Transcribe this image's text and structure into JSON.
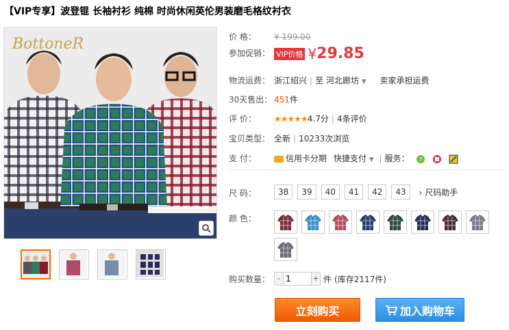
{
  "product": {
    "title": "【VIP专享】波登锟 长袖衬衫 纯棉 时尚休闲英伦男装磨毛格纹衬衣",
    "brand_logo": "BottoneR"
  },
  "price": {
    "label": "价  格：",
    "original": "¥ 199.00",
    "promo_label": "参加促销：",
    "vip_badge": "VIP价格",
    "currency": "¥",
    "current": "29.85"
  },
  "shipping": {
    "label": "物流运费：",
    "from": "浙江绍兴",
    "to_prefix": "至",
    "to": "河北廊坊",
    "fee": "卖家承担运费"
  },
  "sales": {
    "label": "30天售出：",
    "count": "451",
    "unit": "件"
  },
  "rating": {
    "label": "评  价：",
    "stars": "★★★★★",
    "score": "4.7分",
    "reviews": "4条评价"
  },
  "item_type": {
    "label": "宝贝类型：",
    "condition": "全新",
    "views": "10233次浏览"
  },
  "payment": {
    "label": "支  付：",
    "credit": "信用卡分期",
    "quick": "快捷支付",
    "service_label": "服务："
  },
  "sizes": {
    "label": "尺  码：",
    "options": [
      "38",
      "39",
      "40",
      "41",
      "42",
      "43"
    ],
    "helper": "尺码助手"
  },
  "colors": {
    "label": "颜  色：",
    "swatch_colors": [
      "#7a2a3a",
      "#3a8ec8",
      "#b04a5a",
      "#2a3a6a",
      "#2a4a3a",
      "#2a2a5a",
      "#4a2a3a",
      "#7a7a8a",
      "#6a6a7a"
    ]
  },
  "quantity": {
    "label": "购买数量：",
    "value": "1",
    "minus": "-",
    "plus": "+",
    "unit": "件",
    "stock": "(库存2117件)"
  },
  "actions": {
    "buy_now": "立刻购买",
    "add_to_cart": "加入购物车"
  },
  "theme": {
    "price_red": "#e4393c",
    "buy_orange": "#ff6a00",
    "cart_blue": "#2d8de0"
  }
}
